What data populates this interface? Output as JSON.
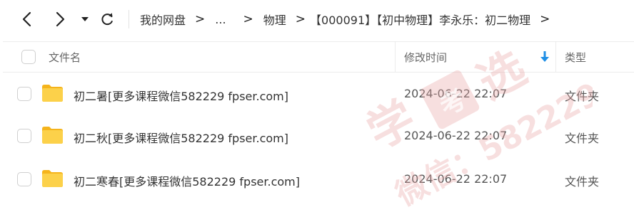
{
  "nav": {
    "back_icon": "chevron-left-icon",
    "forward_icon": "chevron-right-icon",
    "dropdown_icon": "caret-down-icon",
    "refresh_icon": "refresh-icon"
  },
  "breadcrumb": {
    "items": [
      "我的网盘",
      "...",
      "物理",
      "【000091】【初中物理】李永乐：初二物理"
    ],
    "separator": ">"
  },
  "table": {
    "headers": {
      "name": "文件名",
      "mtime": "修改时间",
      "type": "类型"
    },
    "sort_icon": "sort-down-arrow-icon",
    "rows": [
      {
        "name": "初二暑[更多课程微信582229 fpser.com]",
        "mtime": "2024-06-22 22:07",
        "type": "文件夹",
        "icon": "folder-icon"
      },
      {
        "name": "初二秋[更多课程微信582229 fpser.com]",
        "mtime": "2024-06-22 22:07",
        "type": "文件夹",
        "icon": "folder-icon"
      },
      {
        "name": "初二寒春[更多课程微信582229 fpser.com]",
        "mtime": "2024-06-22 22:07",
        "type": "文件夹",
        "icon": "folder-icon"
      }
    ]
  },
  "watermark": {
    "line1": "学",
    "line2": "选",
    "line3": "微信：582229",
    "stamp": "考"
  },
  "colors": {
    "folder": "#fcc934",
    "accent": "#1f8fe6",
    "watermark": "#e8a4a4"
  }
}
